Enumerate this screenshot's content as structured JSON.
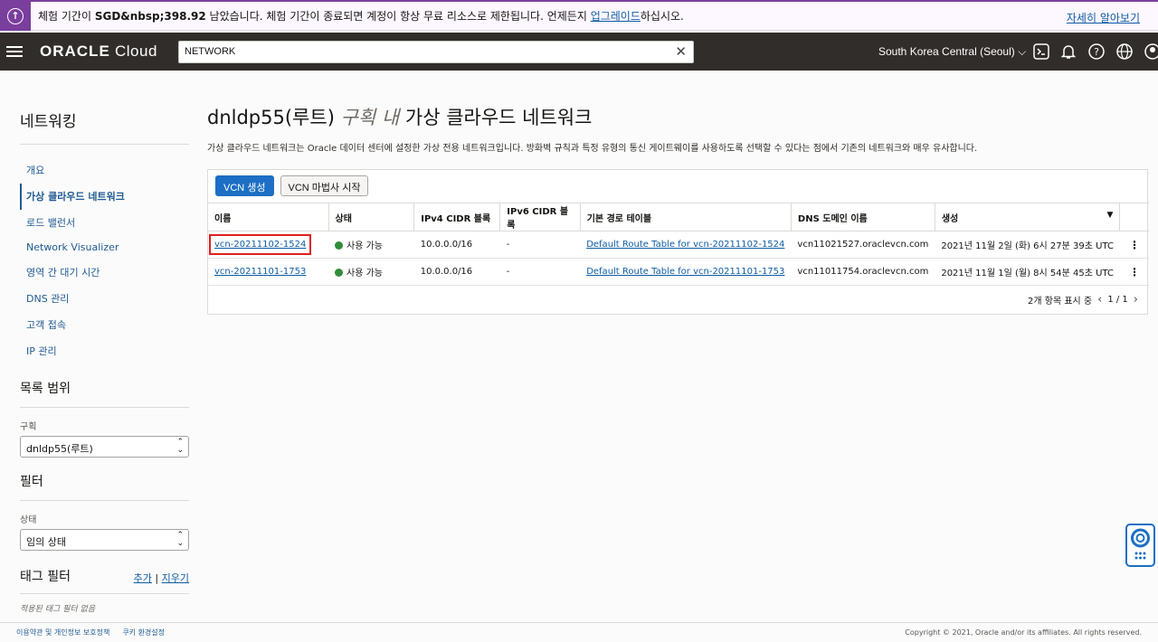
{
  "banner": {
    "prefix": "체험 기간이 ",
    "amount": "SGD&nbsp;398.92",
    "middle": " 남았습니다. 체험 기간이 종료되면 계정이 항상 무료 리소스로 제한됩니다. 언제든지 ",
    "upgrade_link": "업그레이드",
    "suffix": "하십시오.",
    "more_link": "자세히 알아보기"
  },
  "nav": {
    "logo_bold": "ORACLE",
    "logo_rest": " Cloud",
    "search_value": "NETWORK",
    "region": "South Korea Central (Seoul)"
  },
  "sidebar": {
    "title": "네트워킹",
    "items": [
      {
        "label": "개요"
      },
      {
        "label": "가상 클라우드 네트워크"
      },
      {
        "label": "로드 밸런서"
      },
      {
        "label": "Network Visualizer"
      },
      {
        "label": "영역 간 대기 시간"
      },
      {
        "label": "DNS 관리"
      },
      {
        "label": "고객 접속"
      },
      {
        "label": "IP 관리"
      }
    ],
    "scope_title": "목록 범위",
    "compartment_label": "구획",
    "compartment_value": "dnldp55(루트)",
    "filter_title": "필터",
    "state_label": "상태",
    "state_value": "임의 상태",
    "tag_filter_title": "태그 필터",
    "tag_add": "추가",
    "tag_sep": " | ",
    "tag_clear": "지우기",
    "tag_empty": "적용된 태그 필터 없음"
  },
  "main": {
    "title_prefix": "dnldp55(루트) ",
    "title_em": "구획 내",
    "title_suffix": " 가상 클라우드 네트워크",
    "description": "가상 클라우드 네트워크는 Oracle 데이터 센터에 설정한 가상 전용 네트워크입니다. 방화벽 규칙과 특정 유형의 통신 게이트웨이를 사용하도록 선택할 수 있다는 점에서 기존의 네트워크와 매우 유사합니다.",
    "create_button": "VCN 생성",
    "wizard_button": "VCN 마법사 시작",
    "columns": [
      "이름",
      "상태",
      "IPv4 CIDR 블록",
      "IPv6 CIDR 블록",
      "기본 경로 테이블",
      "DNS 도메인 이름",
      "생성"
    ],
    "rows": [
      {
        "name": "vcn-20211102-1524",
        "state": "사용 가능",
        "ipv4": "10.0.0.0/16",
        "ipv6": "-",
        "route_table": "Default Route Table for vcn-20211102-1524",
        "dns": "vcn11021527.oraclevcn.com",
        "created": "2021년 11월 2일 (화) 6시 27분 39초 UTC"
      },
      {
        "name": "vcn-20211101-1753",
        "state": "사용 가능",
        "ipv4": "10.0.0.0/16",
        "ipv6": "-",
        "route_table": "Default Route Table for vcn-20211101-1753",
        "dns": "vcn11011754.oraclevcn.com",
        "created": "2021년 11월 1일 (월) 8시 54분 45초 UTC"
      }
    ],
    "pager_text": "2개 항목 표시 중",
    "pager_page": "1 / 1"
  },
  "footer": {
    "terms": "이용약관 및 개인정보 보호정책",
    "cookies": "쿠키 환경설정",
    "copyright": "Copyright © 2021, Oracle and/or its affiliates. All rights reserved."
  },
  "colors": {
    "brand_nav": "#312d2a",
    "primary": "#1c6fc4",
    "banner_accent": "#7a3e9d",
    "status_ok": "#2f8d3a",
    "highlight": "#e01e1e"
  }
}
